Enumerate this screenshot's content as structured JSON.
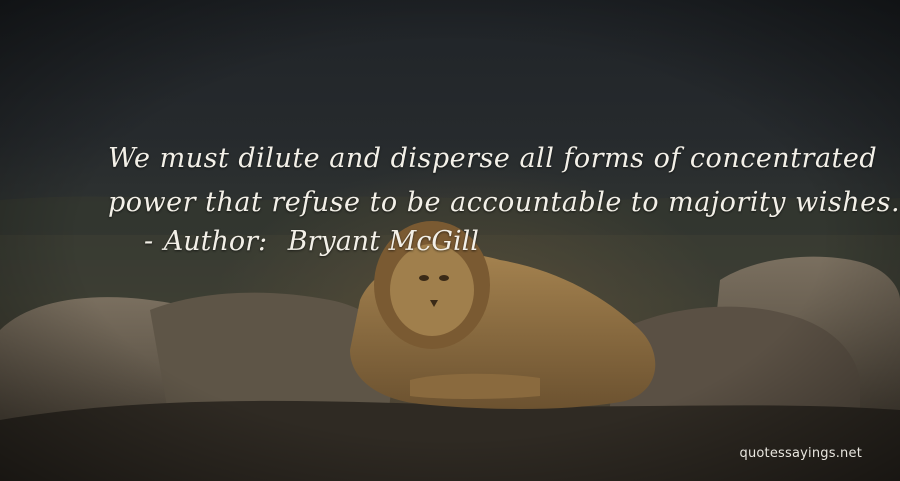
{
  "quote": {
    "line1": "We must dilute and disperse all forms of concentrated",
    "line2": "power that refuse to be accountable to majority wishes."
  },
  "author": {
    "dash": "-",
    "label": "Author:",
    "name": "Bryant McGill"
  },
  "watermark": "quotessayings.net",
  "background_subject": "lion-on-rocks"
}
